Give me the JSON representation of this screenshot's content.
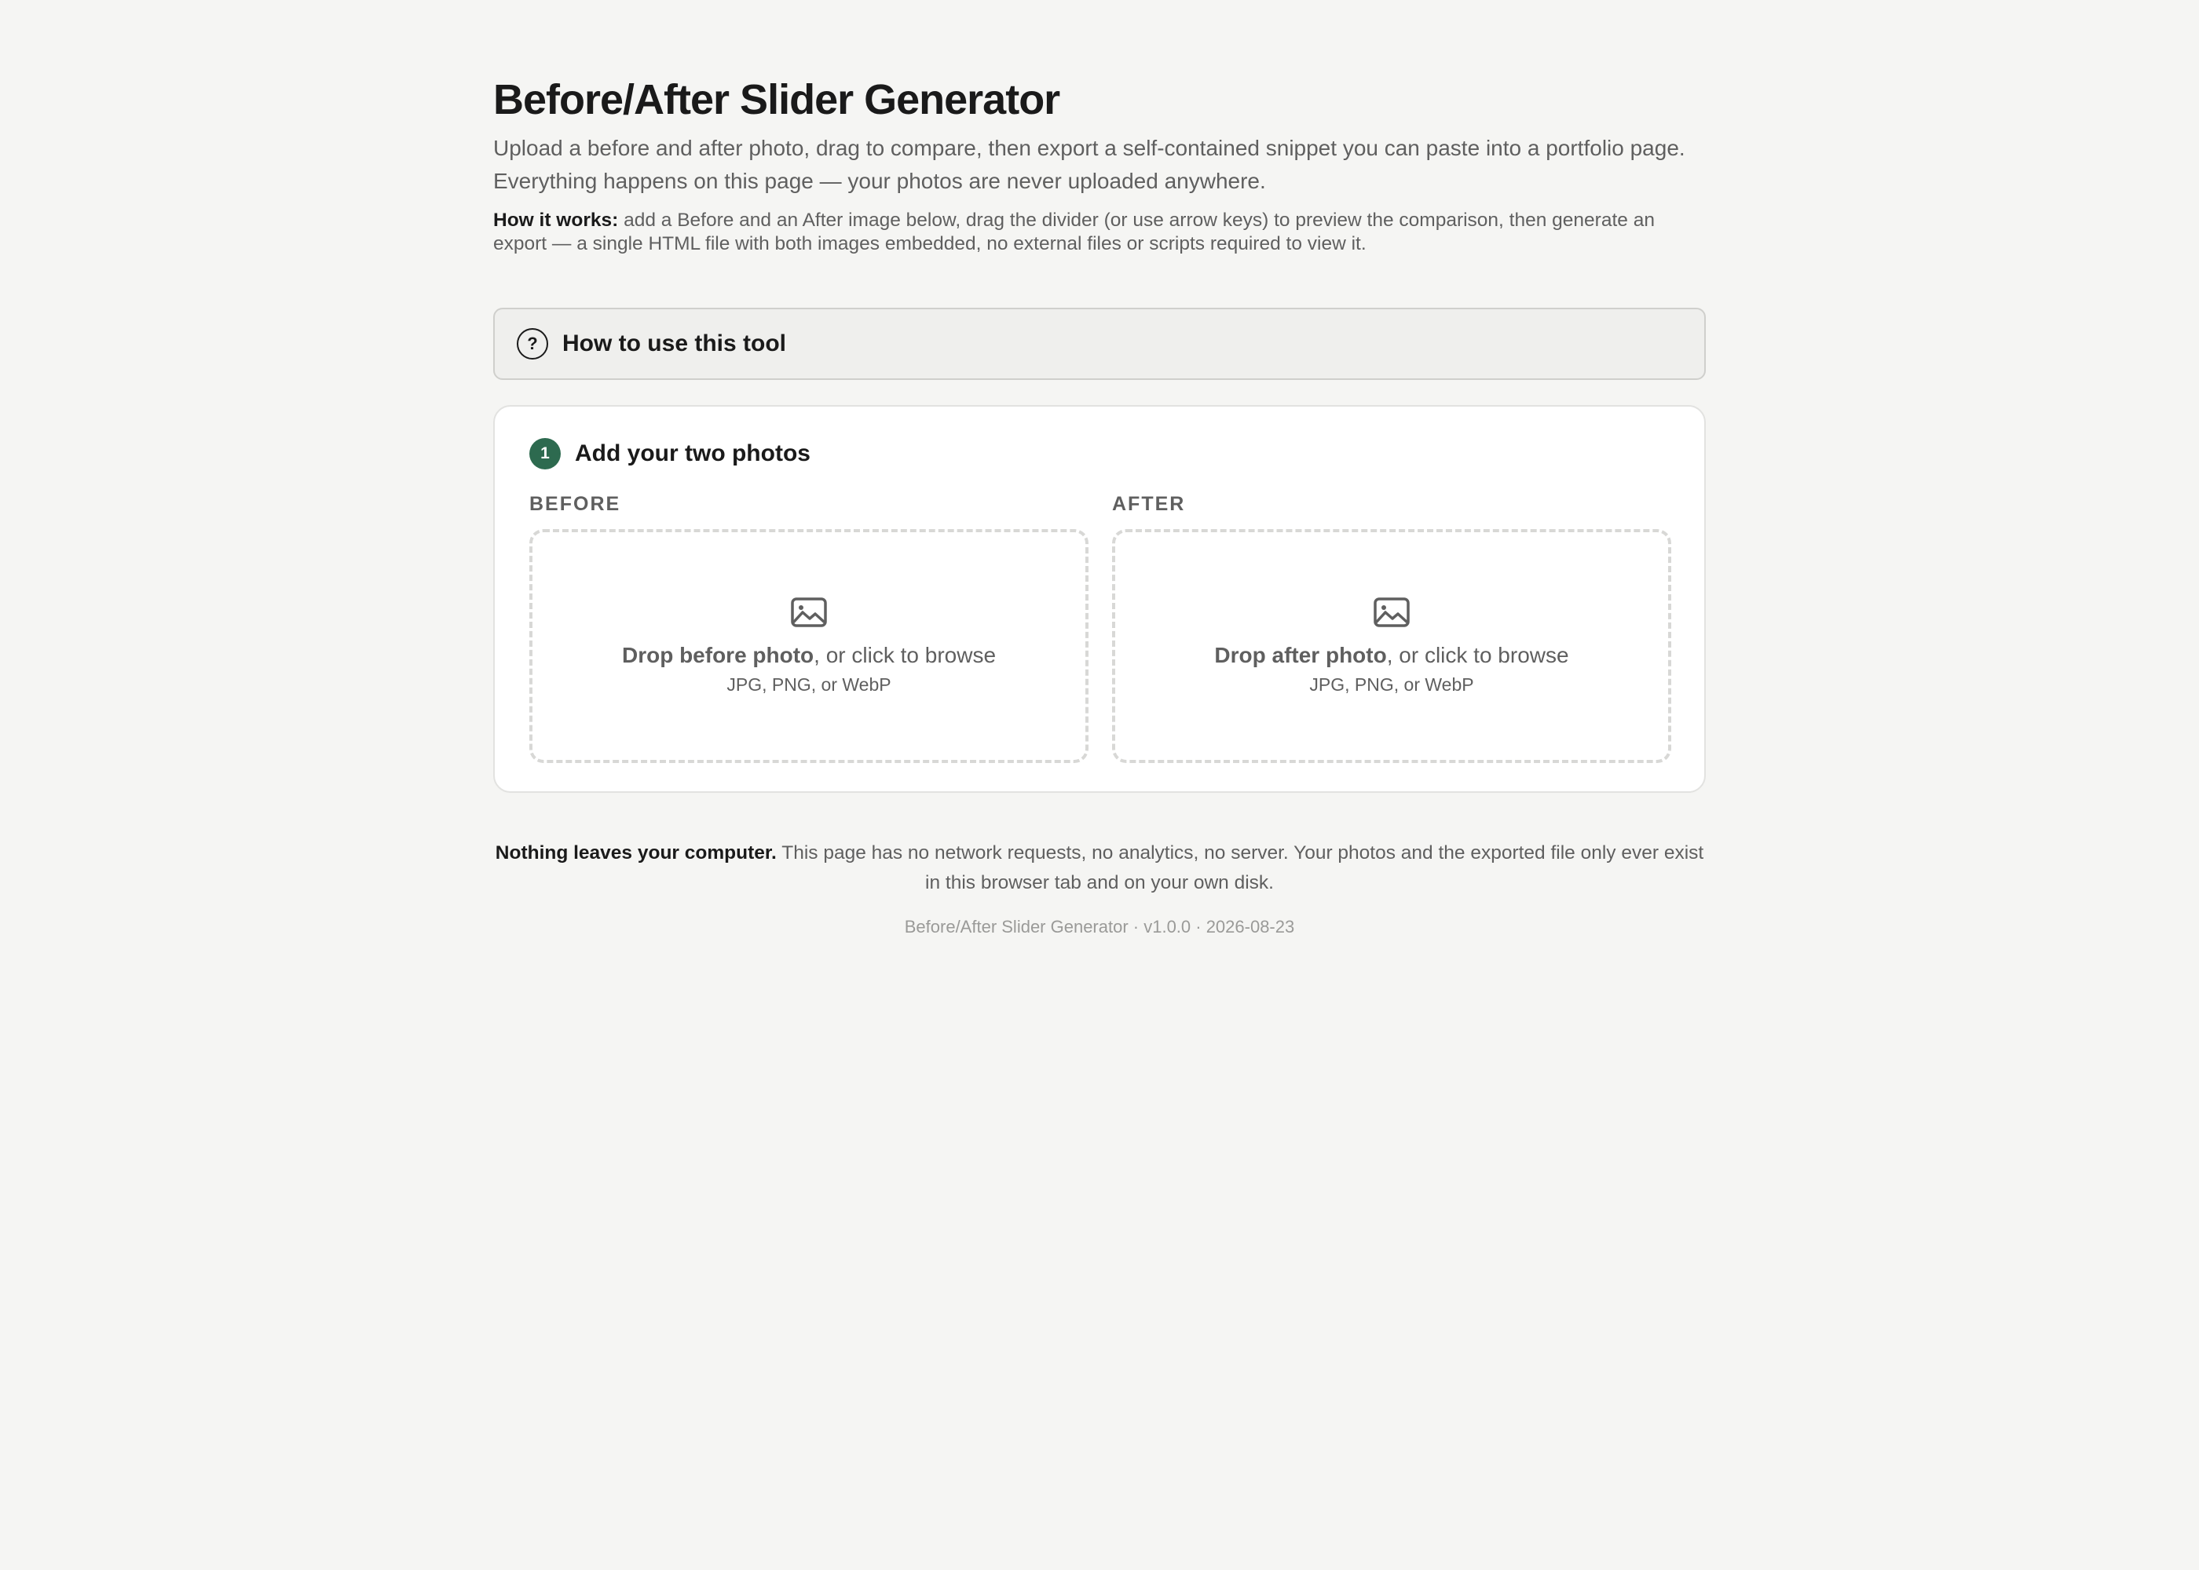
{
  "header": {
    "title": "Before/After Slider Generator",
    "subtitle": "Upload a before and after photo, drag to compare, then export a self-contained snippet you can paste into a portfolio page. Everything happens on this page — your photos are never uploaded anywhere.",
    "how_it_works_label": "How it works:",
    "how_it_works_text": " add a Before and an After image below, drag the divider (or use arrow keys) to preview the comparison, then generate an export — a single HTML file with both images embedded, no external files or scripts required to view it."
  },
  "help": {
    "icon": "question-icon",
    "icon_glyph": "?",
    "label": "How to use this tool"
  },
  "step1": {
    "number": "1",
    "title": "Add your two photos",
    "before": {
      "label": "BEFORE",
      "icon": "image-icon",
      "drop_bold": "Drop before photo",
      "drop_rest": ", or click to browse",
      "formats": "JPG, PNG, or WebP"
    },
    "after": {
      "label": "AFTER",
      "icon": "image-icon",
      "drop_bold": "Drop after photo",
      "drop_rest": ", or click to browse",
      "formats": "JPG, PNG, or WebP"
    }
  },
  "privacy": {
    "bold": "Nothing leaves your computer.",
    "text": " This page has no network requests, no analytics, no server. Your photos and the exported file only ever exist in this browser tab and on your own disk."
  },
  "footer": {
    "text": "Before/After Slider Generator · v1.0.0 · 2026-08-23"
  },
  "colors": {
    "background": "#f5f5f3",
    "accent_green": "#2d6a4f",
    "text_dark": "#1a1a1a",
    "text_muted": "#5f5f5f",
    "text_faint": "#9a9a98",
    "dashed_border": "#d8d8d6"
  }
}
